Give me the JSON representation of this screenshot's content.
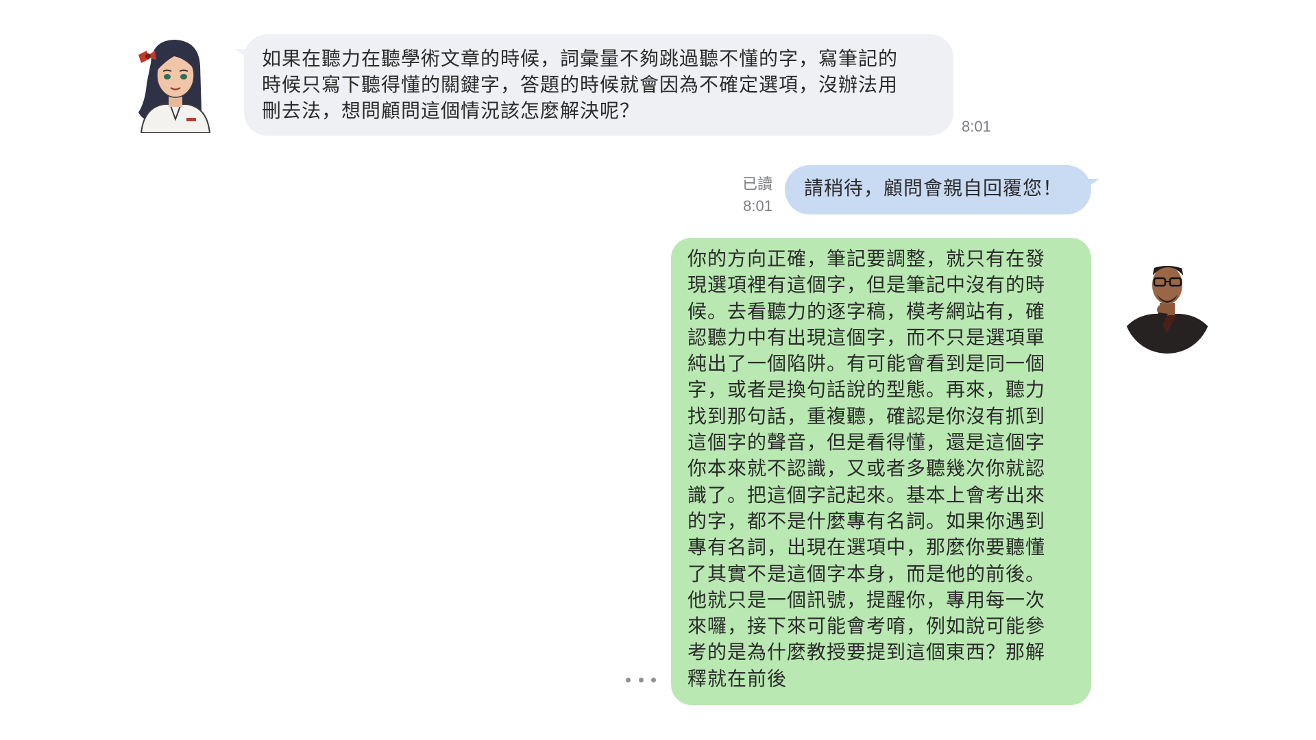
{
  "messages": {
    "incoming": {
      "sender": "student",
      "text": "如果在聽力在聽學術文章的時候，詞彙量不夠跳過聽不懂的字，寫筆記的\n時候只寫下聽得懂的關鍵字，答題的時候就會因為不確定選項，沒辦法用\n刪去法，想問顧問這個情況該怎麼解決呢？",
      "time": "8:01"
    },
    "auto_reply": {
      "read_status": "已讀",
      "time": "8:01",
      "text": "請稍待，顧問會親自回覆您！"
    },
    "advisor_reply": {
      "sender": "advisor",
      "text": "你的方向正確，筆記要調整，就只有在發\n現選項裡有這個字，但是筆記中沒有的時\n候。去看聽力的逐字稿，模考網站有，確\n認聽力中有出現這個字，而不只是選項單\n純出了一個陷阱。有可能會看到是同一個\n字，或者是換句話說的型態。再來，聽力\n找到那句話，重複聽，確認是你沒有抓到\n這個字的聲音，但是看得懂，還是這個字\n你本來就不認識，又或者多聽幾次你就認\n識了。把這個字記起來。基本上會考出來\n的字，都不是什麼專有名詞。如果你遇到\n專有名詞，出現在選項中，那麼你要聽懂\n了其實不是這個字本身，而是他的前後。\n他就只是一個訊號，提醒你，專用每一次\n來囉，接下來可能會考唷，例如說可能參\n考的是為什麼教授要提到這個東西？那解\n釋就在前後"
    }
  },
  "colors": {
    "incoming_bubble": "#eef0f3",
    "system_bubble": "#c9daf3",
    "reply_bubble": "#b9e8b2",
    "meta_text": "#7d7f83"
  },
  "icons": {
    "more": "more-dots-icon"
  }
}
